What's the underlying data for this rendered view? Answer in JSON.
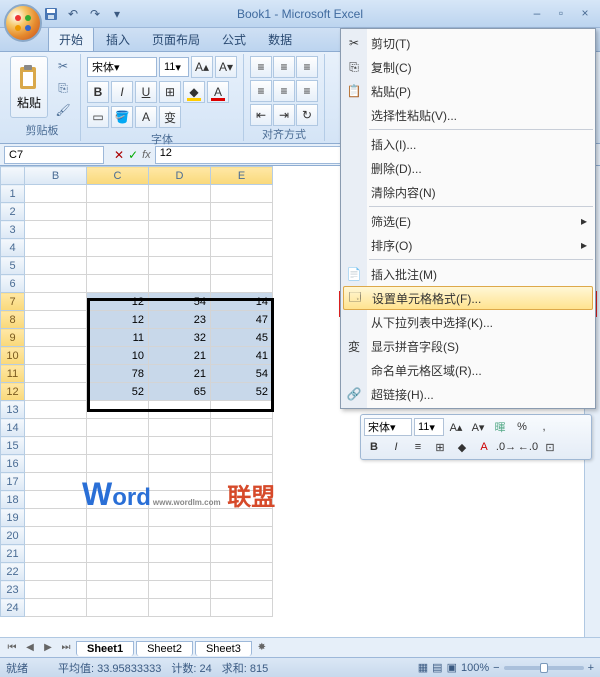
{
  "title": "Book1 - Microsoft Excel",
  "tabs": [
    "开始",
    "插入",
    "页面布局",
    "公式",
    "数据"
  ],
  "ribbon": {
    "paste_label": "粘贴",
    "clipboard_group": "剪贴板",
    "font_group": "字体",
    "align_group": "对齐方式",
    "font_name": "宋体",
    "font_size": "11"
  },
  "namebox": "C7",
  "formula_value": "12",
  "columns": [
    "B",
    "C",
    "D",
    "E"
  ],
  "rows_visible": [
    1,
    2,
    3,
    4,
    5,
    6,
    7,
    8,
    9,
    10,
    11,
    12,
    13,
    14,
    15,
    16,
    17,
    18,
    19,
    20,
    21,
    22,
    23,
    24
  ],
  "selected_rows": [
    7,
    8,
    9,
    10,
    11,
    12
  ],
  "selected_cols": [
    "C",
    "D",
    "E"
  ],
  "cells": {
    "C7": "12",
    "D7": "54",
    "E7": "14",
    "C8": "12",
    "D8": "23",
    "E8": "47",
    "C9": "11",
    "D9": "32",
    "E9": "45",
    "C10": "10",
    "D10": "21",
    "E10": "41",
    "C11": "78",
    "D11": "21",
    "E11": "54",
    "C12": "52",
    "D12": "65",
    "E12": "52"
  },
  "context_menu": [
    {
      "icon": "cut",
      "label": "剪切(T)"
    },
    {
      "icon": "copy",
      "label": "复制(C)"
    },
    {
      "icon": "paste",
      "label": "粘贴(P)"
    },
    {
      "icon": "",
      "label": "选择性粘贴(V)..."
    },
    {
      "sep": true
    },
    {
      "icon": "",
      "label": "插入(I)..."
    },
    {
      "icon": "",
      "label": "删除(D)..."
    },
    {
      "icon": "",
      "label": "清除内容(N)"
    },
    {
      "sep": true
    },
    {
      "icon": "",
      "label": "筛选(E)",
      "arrow": true
    },
    {
      "icon": "",
      "label": "排序(O)",
      "arrow": true
    },
    {
      "sep": true
    },
    {
      "icon": "comment",
      "label": "插入批注(M)"
    },
    {
      "icon": "format",
      "label": "设置单元格格式(F)...",
      "highlight": true
    },
    {
      "icon": "",
      "label": "从下拉列表中选择(K)..."
    },
    {
      "icon": "pinyin",
      "label": "显示拼音字段(S)"
    },
    {
      "icon": "",
      "label": "命名单元格区域(R)..."
    },
    {
      "icon": "link",
      "label": "超链接(H)..."
    }
  ],
  "mini_toolbar": {
    "font": "宋体",
    "size": "11"
  },
  "sheet_tabs": [
    "Sheet1",
    "Sheet2",
    "Sheet3"
  ],
  "status": {
    "ready": "就绪",
    "avg_label": "平均值:",
    "avg": "33.95833333",
    "count_label": "计数:",
    "count": "24",
    "sum_label": "求和:",
    "sum": "815",
    "zoom": "100%"
  },
  "watermark": {
    "w": "W",
    "ord": "ord",
    "url": "www.wordlm.com",
    "cn": "联盟"
  }
}
